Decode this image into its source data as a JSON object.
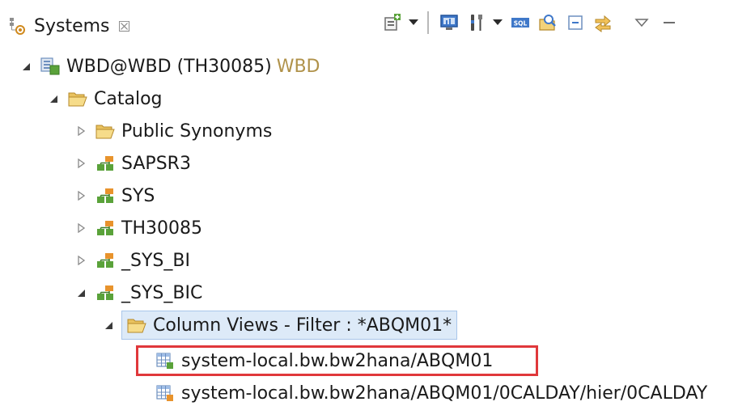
{
  "tab": {
    "icon": "systems-view-icon",
    "label": "Systems",
    "close_glyph": "☒"
  },
  "toolbar": {
    "buttons": [
      {
        "name": "add-system-button",
        "icon": "add-system-icon",
        "dropdown": true
      },
      {
        "name": "open-admin-console-button",
        "icon": "monitor-icon",
        "dropdown": false
      },
      {
        "name": "configure-button",
        "icon": "tools-icon",
        "dropdown": true
      },
      {
        "name": "open-sql-console-button",
        "icon": "sql-console-icon",
        "dropdown": false
      },
      {
        "name": "find-table-button",
        "icon": "find-object-icon",
        "dropdown": false
      },
      {
        "name": "collapse-all-button",
        "icon": "collapse-all-icon",
        "dropdown": false
      },
      {
        "name": "link-with-editor-button",
        "icon": "link-editor-icon",
        "dropdown": false
      },
      {
        "name": "view-menu-button",
        "icon": "view-menu-icon",
        "dropdown": false
      },
      {
        "name": "minimize-button",
        "icon": "minimize-icon",
        "dropdown": false
      }
    ]
  },
  "tree": {
    "system": {
      "label": "WBD@WBD (TH30085)",
      "decoration": "WBD",
      "expanded": true
    },
    "catalog": {
      "label": "Catalog",
      "expanded": true
    },
    "public_synonyms": {
      "label": "Public Synonyms",
      "expanded": false
    },
    "schemas": [
      {
        "label": "SAPSR3",
        "expanded": false
      },
      {
        "label": "SYS",
        "expanded": false
      },
      {
        "label": "TH30085",
        "expanded": false
      },
      {
        "label": "_SYS_BI",
        "expanded": false
      },
      {
        "label": "_SYS_BIC",
        "expanded": true
      }
    ],
    "column_views": {
      "label": "Column Views - Filter : *ABQM01*",
      "expanded": true,
      "selected": true
    },
    "views": [
      {
        "label": "system-local.bw.bw2hana/ABQM01",
        "highlighted": true
      },
      {
        "label": "system-local.bw.bw2hana/ABQM01/0CALDAY/hier/0CALDAY",
        "highlighted": false
      }
    ]
  },
  "colors": {
    "selection_bg": "#ddeaf8",
    "highlight_border": "#e0383b",
    "decoration_text": "#b0924a",
    "folder_fill": "#f2d27a",
    "schema_green": "#5aa23a",
    "schema_orange": "#e8932c"
  }
}
